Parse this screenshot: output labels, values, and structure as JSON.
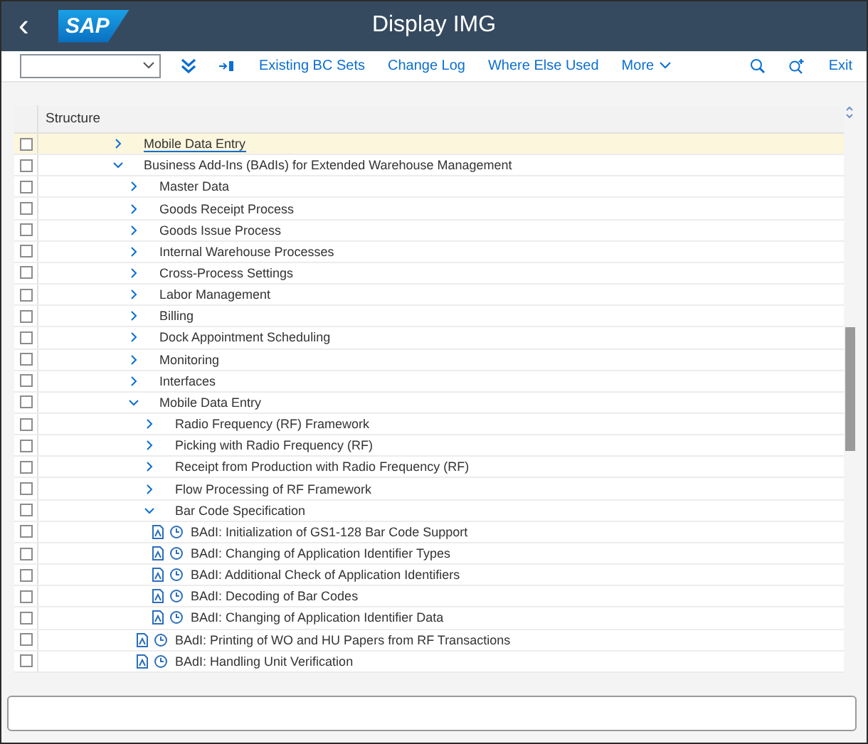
{
  "header": {
    "back": "‹",
    "logo": "SAP",
    "title": "Display IMG"
  },
  "toolbar": {
    "actions": [
      {
        "kind": "expand"
      },
      {
        "kind": "jump"
      },
      {
        "kind": "text",
        "label": "Existing BC Sets"
      },
      {
        "kind": "text",
        "label": "Change Log"
      },
      {
        "kind": "text",
        "label": "Where Else Used"
      },
      {
        "kind": "menu",
        "label": "More"
      }
    ],
    "right": [
      {
        "kind": "search"
      },
      {
        "kind": "findnext"
      },
      {
        "kind": "text",
        "label": "Exit"
      }
    ]
  },
  "tree": {
    "column": "Structure",
    "items": [
      {
        "label": "Mobile Data Entry",
        "kind": "folder",
        "expanded": false,
        "selected": true,
        "checked": false
      },
      {
        "label": "Business Add-Ins (BAdIs) for Extended Warehouse Management",
        "kind": "folder",
        "expanded": true,
        "selected": false,
        "checked": false,
        "children": [
          {
            "label": "Master Data",
            "kind": "folder",
            "expanded": false,
            "selected": false,
            "checked": false
          },
          {
            "label": "Goods Receipt Process",
            "kind": "folder",
            "expanded": false,
            "selected": false,
            "checked": false
          },
          {
            "label": "Goods Issue Process",
            "kind": "folder",
            "expanded": false,
            "selected": false,
            "checked": false
          },
          {
            "label": "Internal Warehouse Processes",
            "kind": "folder",
            "expanded": false,
            "selected": false,
            "checked": false
          },
          {
            "label": "Cross-Process Settings",
            "kind": "folder",
            "expanded": false,
            "selected": false,
            "checked": false
          },
          {
            "label": "Labor Management",
            "kind": "folder",
            "expanded": false,
            "selected": false,
            "checked": false
          },
          {
            "label": "Billing",
            "kind": "folder",
            "expanded": false,
            "selected": false,
            "checked": false
          },
          {
            "label": "Dock Appointment Scheduling",
            "kind": "folder",
            "expanded": false,
            "selected": false,
            "checked": false
          },
          {
            "label": "Monitoring",
            "kind": "folder",
            "expanded": false,
            "selected": false,
            "checked": false
          },
          {
            "label": "Interfaces",
            "kind": "folder",
            "expanded": false,
            "selected": false,
            "checked": false
          },
          {
            "label": "Mobile Data Entry",
            "kind": "folder",
            "expanded": true,
            "selected": false,
            "checked": false,
            "children": [
              {
                "label": "Radio Frequency (RF) Framework",
                "kind": "folder",
                "expanded": false,
                "selected": false,
                "checked": false
              },
              {
                "label": "Picking with Radio Frequency (RF)",
                "kind": "folder",
                "expanded": false,
                "selected": false,
                "checked": false
              },
              {
                "label": "Receipt from Production with Radio Frequency (RF)",
                "kind": "folder",
                "expanded": false,
                "selected": false,
                "checked": false
              },
              {
                "label": "Flow Processing of RF Framework",
                "kind": "folder",
                "expanded": false,
                "selected": false,
                "checked": false
              },
              {
                "label": "Bar Code Specification",
                "kind": "folder",
                "expanded": true,
                "selected": false,
                "checked": false,
                "children": [
                  {
                    "label": "BAdI: Initialization of GS1-128 Bar Code Support",
                    "kind": "activity",
                    "selected": false,
                    "checked": false
                  },
                  {
                    "label": "BAdI: Changing of Application Identifier Types",
                    "kind": "activity",
                    "selected": false,
                    "checked": false
                  },
                  {
                    "label": "BAdI: Additional Check of Application Identifiers",
                    "kind": "activity",
                    "selected": false,
                    "checked": false
                  },
                  {
                    "label": "BAdI: Decoding of Bar Codes",
                    "kind": "activity",
                    "selected": false,
                    "checked": false
                  },
                  {
                    "label": "BAdI: Changing of Application Identifier Data",
                    "kind": "activity",
                    "selected": false,
                    "checked": false
                  }
                ]
              },
              {
                "label": "BAdI: Printing of WO and HU Papers from RF Transactions",
                "kind": "activity",
                "selected": false,
                "checked": false
              },
              {
                "label": "BAdI: Handling Unit Verification",
                "kind": "activity",
                "selected": false,
                "checked": false
              }
            ]
          }
        ]
      }
    ]
  }
}
